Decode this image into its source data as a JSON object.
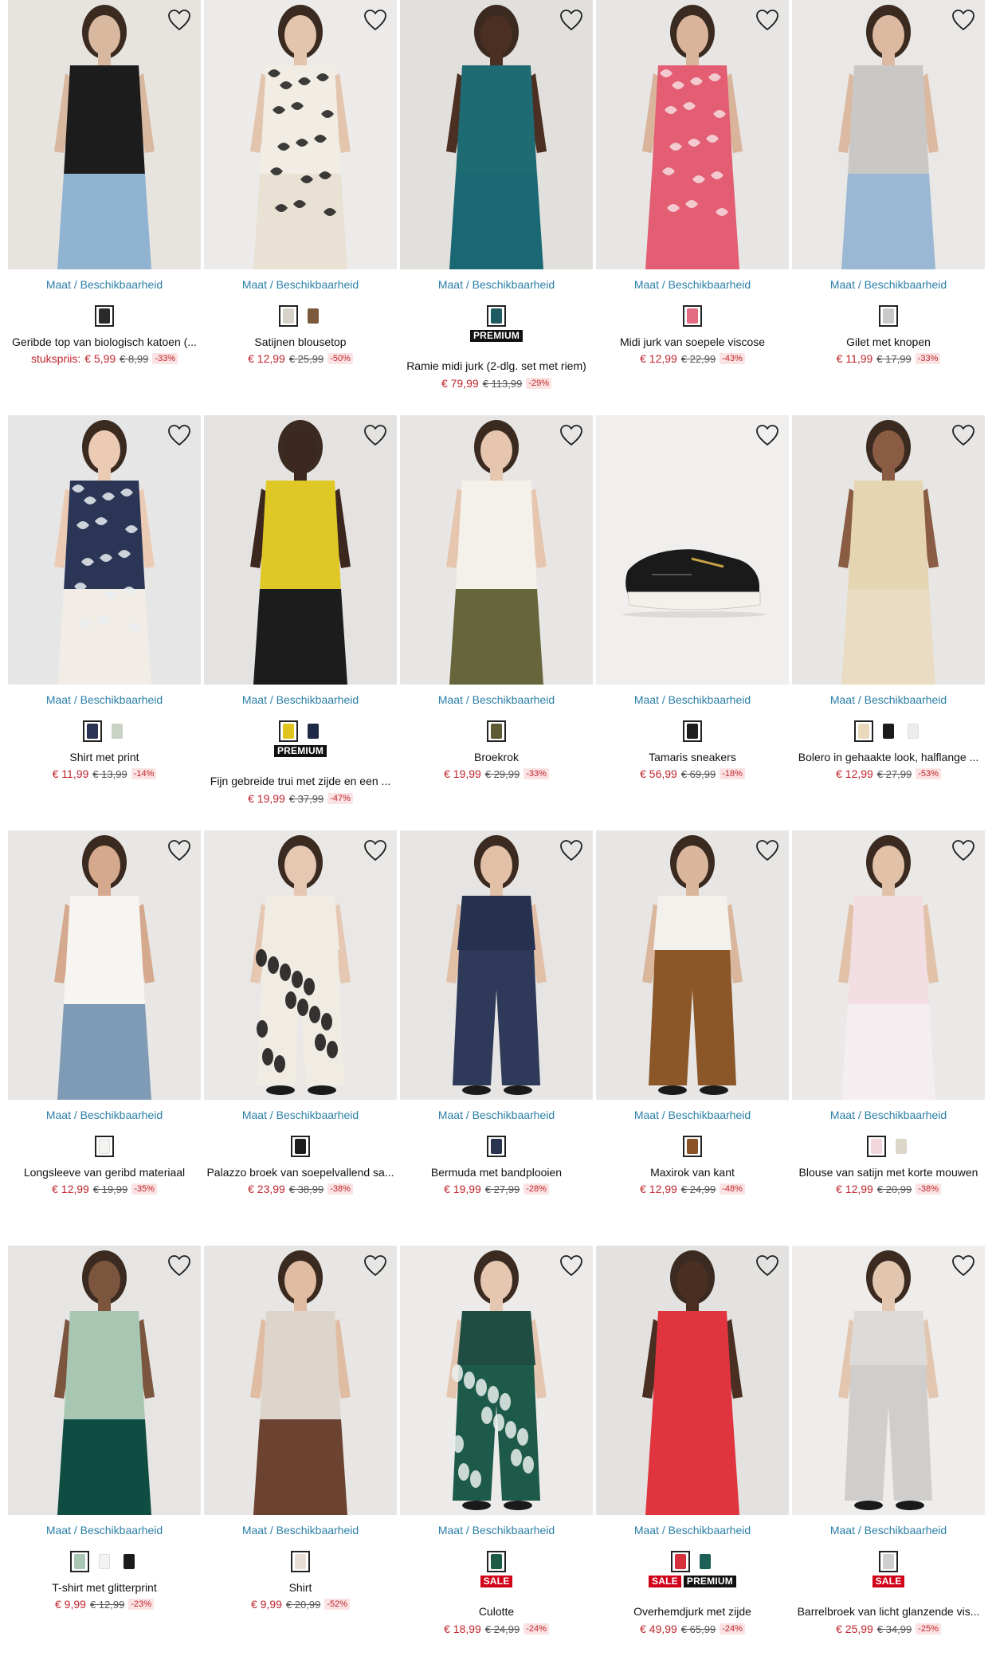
{
  "ui": {
    "size_link_label": "Maat / Beschikbaarheid",
    "colors": {
      "link": "#2b7fa8",
      "price": "#c0252d",
      "discount_bg": "#fbe3e3",
      "sale_badge": "#d0021b",
      "premium_badge": "#111111"
    }
  },
  "products": [
    {
      "title": "Geribde top van biologisch katoen (...",
      "price_label": "stukspriis:",
      "price": "€ 5,99",
      "old_price": "€ 8,99",
      "discount": "-33%",
      "badges": [],
      "swatches": [
        "#2a2a2a"
      ],
      "image": {
        "bg": "#e7e4e0",
        "garment": "#1c1c1c",
        "skin": "#d9b8a0",
        "lower": "#8fb3d1"
      }
    },
    {
      "title": "Satijnen blousetop",
      "price_label": "",
      "price": "€ 12,99",
      "old_price": "€ 25,99",
      "discount": "-50%",
      "badges": [],
      "swatches": [
        "#d8d3c8",
        "#7b5a3c"
      ],
      "image": {
        "bg": "#ecebea",
        "garment": "#f1ede4",
        "skin": "#e3c4ad",
        "lower": "#e8e1d4",
        "pattern": "#1b1b1b"
      }
    },
    {
      "title": "Ramie midi jurk (2-dlg. set met riem)",
      "price_label": "",
      "price": "€ 79,99",
      "old_price": "€ 113,99",
      "discount": "-29%",
      "badges": [
        "PREMIUM"
      ],
      "swatches": [
        "#1e5b63"
      ],
      "image": {
        "bg": "#e2e0dd",
        "garment": "#1f6b74",
        "skin": "#4b2f22",
        "lower": "#196874"
      }
    },
    {
      "title": "Midi jurk van soepele viscose",
      "price_label": "",
      "price": "€ 12,99",
      "old_price": "€ 22,99",
      "discount": "-43%",
      "badges": [],
      "swatches": [
        "#e46a80"
      ],
      "image": {
        "bg": "#e7e6e4",
        "garment": "#e35d73",
        "skin": "#d9b39a",
        "lower": "#e35d73",
        "pattern": "#f6dde1"
      }
    },
    {
      "title": "Gilet met knopen",
      "price_label": "",
      "price": "€ 11,99",
      "old_price": "€ 17,99",
      "discount": "-33%",
      "badges": [],
      "swatches": [
        "#c9c9c9"
      ],
      "image": {
        "bg": "#e9e8e6",
        "garment": "#c9c8c6",
        "skin": "#dcb9a1",
        "lower": "#9ab8d3"
      }
    },
    {
      "title": "Shirt met print",
      "price_label": "",
      "price": "€ 11,99",
      "old_price": "€ 13,99",
      "discount": "-14%",
      "badges": [],
      "swatches": [
        "#2a3353",
        "#c9d3c4"
      ],
      "image": {
        "bg": "#e6e6e6",
        "garment": "#2b3556",
        "skin": "#eccbb5",
        "lower": "#f1ece6",
        "pattern": "#e9eef2"
      }
    },
    {
      "title": "Fijn gebreide trui met zijde en een ...",
      "price_label": "",
      "price": "€ 19,99",
      "old_price": "€ 37,99",
      "discount": "-47%",
      "badges": [
        "PREMIUM"
      ],
      "swatches": [
        "#e2c41f",
        "#1f2a48"
      ],
      "image": {
        "bg": "#e4e3e1",
        "garment": "#dfc825",
        "skin": "#3b271d",
        "lower": "#1c1c1c"
      }
    },
    {
      "title": "Broekrok",
      "price_label": "",
      "price": "€ 19,99",
      "old_price": "€ 29,99",
      "discount": "-33%",
      "badges": [],
      "swatches": [
        "#5d5a34"
      ],
      "image": {
        "bg": "#e7e6e4",
        "garment": "#f4f1ea",
        "skin": "#e6c6ae",
        "lower": "#67653c"
      }
    },
    {
      "title": "Tamaris sneakers",
      "price_label": "",
      "price": "€ 56,99",
      "old_price": "€ 69,99",
      "discount": "-18%",
      "badges": [],
      "swatches": [
        "#1e1e1e"
      ],
      "image": {
        "bg": "#f0efee",
        "garment": "#1a1a1a",
        "skin": "#f0efee",
        "lower": "#f0efee",
        "shoe": true
      }
    },
    {
      "title": "Bolero in gehaakte look, halflange ...",
      "price_label": "",
      "price": "€ 12,99",
      "old_price": "€ 27,99",
      "discount": "-53%",
      "badges": [],
      "swatches": [
        "#e8d9bb",
        "#1b1b1b",
        "#ececec"
      ],
      "image": {
        "bg": "#e7e6e4",
        "garment": "#e6d5b3",
        "skin": "#8a5c43",
        "lower": "#e9dcc3"
      }
    },
    {
      "title": "Longsleeve van geribd materiaal",
      "price_label": "",
      "price": "€ 12,99",
      "old_price": "€ 19,99",
      "discount": "-35%",
      "badges": [],
      "swatches": [
        "#f5f3ef"
      ],
      "image": {
        "bg": "#e8e7e5",
        "garment": "#f7f5f1",
        "skin": "#d4a98e",
        "lower": "#7f9ab5"
      }
    },
    {
      "title": "Palazzo broek van soepelvallend sa...",
      "price_label": "",
      "price": "€ 23,99",
      "old_price": "€ 38,99",
      "discount": "-38%",
      "badges": [],
      "swatches": [
        "#1c1c1c"
      ],
      "image": {
        "bg": "#e9e8e6",
        "garment": "#f0ece4",
        "skin": "#e5c7b2",
        "lower": "#f0ece4",
        "pattern": "#121212",
        "pants": true
      }
    },
    {
      "title": "Bermuda met bandplooien",
      "price_label": "",
      "price": "€ 19,99",
      "old_price": "€ 27,99",
      "discount": "-28%",
      "badges": [],
      "swatches": [
        "#2a3350"
      ],
      "image": {
        "bg": "#e6e5e3",
        "garment": "#263150",
        "skin": "#e2c0a7",
        "lower": "#2f3a5a",
        "pants": true
      }
    },
    {
      "title": "Maxirok van kant",
      "price_label": "",
      "price": "€ 12,99",
      "old_price": "€ 24,99",
      "discount": "-48%",
      "badges": [],
      "swatches": [
        "#8a5327"
      ],
      "image": {
        "bg": "#e7e6e4",
        "garment": "#f3f1ec",
        "skin": "#d9b69c",
        "lower": "#8b5728",
        "pants": true
      }
    },
    {
      "title": "Blouse van satijn met korte mouwen",
      "price_label": "",
      "price": "€ 12,99",
      "old_price": "€ 20,99",
      "discount": "-38%",
      "badges": [],
      "swatches": [
        "#f3d7dd",
        "#dcd6c8"
      ],
      "image": {
        "bg": "#eae9e7",
        "garment": "#f2dde2",
        "skin": "#e1c1a8",
        "lower": "#f5eef0"
      }
    },
    {
      "title": "T-shirt met glitterprint",
      "price_label": "",
      "price": "€ 9,99",
      "old_price": "€ 12,99",
      "discount": "-23%",
      "badges": [],
      "swatches": [
        "#a9c6b4",
        "#f3f3f3",
        "#1b1b1b"
      ],
      "image": {
        "bg": "#e6e5e3",
        "garment": "#a8c7b3",
        "skin": "#7c553f",
        "lower": "#0f4d43"
      }
    },
    {
      "title": "Shirt",
      "price_label": "",
      "price": "€ 9,99",
      "old_price": "€ 20,99",
      "discount": "-52%",
      "badges": [],
      "swatches": [
        "#e9ded5"
      ],
      "image": {
        "bg": "#e7e6e4",
        "garment": "#ddd5cc",
        "skin": "#e0bca2",
        "lower": "#6b4330"
      }
    },
    {
      "title": "Culotte",
      "price_label": "",
      "price": "€ 18,99",
      "old_price": "€ 24,99",
      "discount": "-24%",
      "badges": [
        "SALE"
      ],
      "swatches": [
        "#1e5a48"
      ],
      "image": {
        "bg": "#ecebe9",
        "garment": "#1f4d42",
        "skin": "#e5c7b1",
        "lower": "#1e5a4a",
        "pattern": "#e9f0ec",
        "pants": true
      }
    },
    {
      "title": "Overhemdjurk met zijde",
      "price_label": "",
      "price": "€ 49,99",
      "old_price": "€ 65,99",
      "discount": "-24%",
      "badges": [
        "SALE",
        "PREMIUM"
      ],
      "swatches": [
        "#d5303c",
        "#1d5e57"
      ],
      "image": {
        "bg": "#e3e2e0",
        "garment": "#e0353f",
        "skin": "#4a2e22",
        "lower": "#e0353f"
      }
    },
    {
      "title": "Barrelbroek van licht glanzende vis...",
      "price_label": "",
      "price": "€ 25,99",
      "old_price": "€ 34,99",
      "discount": "-25%",
      "badges": [
        "SALE"
      ],
      "swatches": [
        "#cfcfcd"
      ],
      "image": {
        "bg": "#eeedeb",
        "garment": "#dcdbd9",
        "skin": "#e3c6b0",
        "lower": "#cfcecc",
        "pants": true
      }
    }
  ]
}
